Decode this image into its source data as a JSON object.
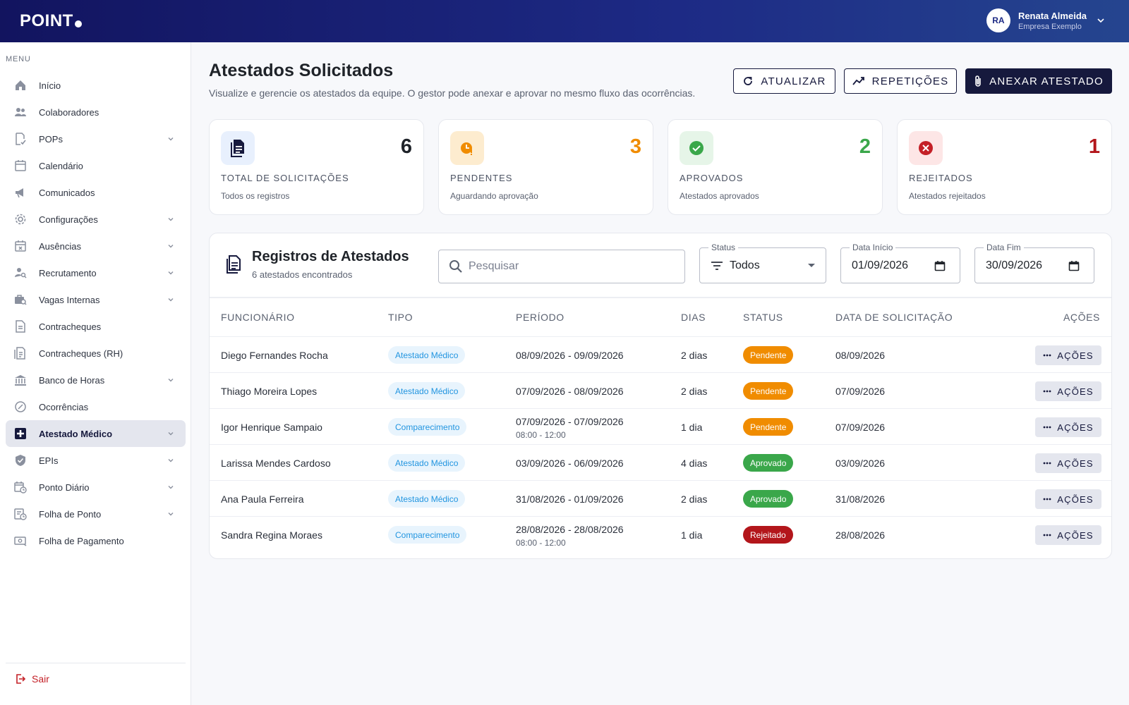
{
  "header": {
    "logo": "POINT",
    "avatar": "RA",
    "user_name": "Renata Almeida",
    "company": "Empresa Exemplo"
  },
  "sidebar": {
    "menu_title": "MENU",
    "items": [
      {
        "label": "Início",
        "icon": "home-icon",
        "expandable": false
      },
      {
        "label": "Colaboradores",
        "icon": "people-icon",
        "expandable": false
      },
      {
        "label": "POPs",
        "icon": "document-check-icon",
        "expandable": true
      },
      {
        "label": "Calendário",
        "icon": "calendar-icon",
        "expandable": false
      },
      {
        "label": "Comunicados",
        "icon": "megaphone-icon",
        "expandable": false
      },
      {
        "label": "Configurações",
        "icon": "gear-icon",
        "expandable": true
      },
      {
        "label": "Ausências",
        "icon": "calendar-x-icon",
        "expandable": true
      },
      {
        "label": "Recrutamento",
        "icon": "person-search-icon",
        "expandable": true
      },
      {
        "label": "Vagas Internas",
        "icon": "briefcase-search-icon",
        "expandable": true
      },
      {
        "label": "Contracheques",
        "icon": "receipt-icon",
        "expandable": false
      },
      {
        "label": "Contracheques (RH)",
        "icon": "receipt-list-icon",
        "expandable": false
      },
      {
        "label": "Banco de Horas",
        "icon": "bank-icon",
        "expandable": true
      },
      {
        "label": "Ocorrências",
        "icon": "circle-slash-icon",
        "expandable": false
      },
      {
        "label": "Atestado Médico",
        "icon": "medical-cross-icon",
        "expandable": true,
        "active": true
      },
      {
        "label": "EPIs",
        "icon": "shield-check-icon",
        "expandable": true
      },
      {
        "label": "Ponto Diário",
        "icon": "calendar-clock-icon",
        "expandable": true
      },
      {
        "label": "Folha de Ponto",
        "icon": "timesheet-icon",
        "expandable": true
      },
      {
        "label": "Folha de Pagamento",
        "icon": "payment-icon",
        "expandable": false
      }
    ],
    "logout": "Sair"
  },
  "page": {
    "title": "Atestados Solicitados",
    "subtitle": "Visualize e gerencie os atestados da equipe. O gestor pode anexar e aprovar no mesmo fluxo das ocorrências.",
    "buttons": {
      "refresh": "ATUALIZAR",
      "repeats": "REPETIÇÕES",
      "attach": "ANEXAR ATESTADO"
    }
  },
  "kpis": [
    {
      "value": "6",
      "label": "TOTAL DE SOLICITAÇÕES",
      "desc": "Todos os registros",
      "color": "#1f2329",
      "bg": "#e8f0fd"
    },
    {
      "value": "3",
      "label": "PENDENTES",
      "desc": "Aguardando aprovação",
      "color": "#f08c00",
      "bg": "#fdeccf"
    },
    {
      "value": "2",
      "label": "APROVADOS",
      "desc": "Atestados aprovados",
      "color": "#3aa74a",
      "bg": "#e6f5e8"
    },
    {
      "value": "1",
      "label": "REJEITADOS",
      "desc": "Atestados rejeitados",
      "color": "#b3161b",
      "bg": "#fde6e6"
    }
  ],
  "records": {
    "title": "Registros de Atestados",
    "count_text": "6 atestados encontrados",
    "search_placeholder": "Pesquisar",
    "filters": {
      "status_label": "Status",
      "status_value": "Todos",
      "start_label": "Data Início",
      "start_value": "01/09/2026",
      "end_label": "Data Fim",
      "end_value": "30/09/2026"
    },
    "columns": [
      "FUNCIONÁRIO",
      "TIPO",
      "PERÍODO",
      "DIAS",
      "STATUS",
      "DATA DE SOLICITAÇÃO",
      "AÇÕES"
    ],
    "action_label": "AÇÕES",
    "rows": [
      {
        "employee": "Diego Fernandes Rocha",
        "type": "Atestado Médico",
        "period": "08/09/2026 - 09/09/2026",
        "time": "",
        "days": "2 dias",
        "status": "Pendente",
        "date": "08/09/2026"
      },
      {
        "employee": "Thiago Moreira Lopes",
        "type": "Atestado Médico",
        "period": "07/09/2026 - 08/09/2026",
        "time": "",
        "days": "2 dias",
        "status": "Pendente",
        "date": "07/09/2026"
      },
      {
        "employee": "Igor Henrique Sampaio",
        "type": "Comparecimento",
        "period": "07/09/2026 - 07/09/2026",
        "time": "08:00 - 12:00",
        "days": "1 dia",
        "status": "Pendente",
        "date": "07/09/2026"
      },
      {
        "employee": "Larissa Mendes Cardoso",
        "type": "Atestado Médico",
        "period": "03/09/2026 - 06/09/2026",
        "time": "",
        "days": "4 dias",
        "status": "Aprovado",
        "date": "03/09/2026"
      },
      {
        "employee": "Ana Paula Ferreira",
        "type": "Atestado Médico",
        "period": "31/08/2026 - 01/09/2026",
        "time": "",
        "days": "2 dias",
        "status": "Aprovado",
        "date": "31/08/2026"
      },
      {
        "employee": "Sandra Regina Moraes",
        "type": "Comparecimento",
        "period": "28/08/2026 - 28/08/2026",
        "time": "08:00 - 12:00",
        "days": "1 dia",
        "status": "Rejeitado",
        "date": "28/08/2026"
      }
    ]
  },
  "status_colors": {
    "Pendente": "#f08c00",
    "Aprovado": "#3aa74a",
    "Rejeitado": "#b3161b"
  }
}
